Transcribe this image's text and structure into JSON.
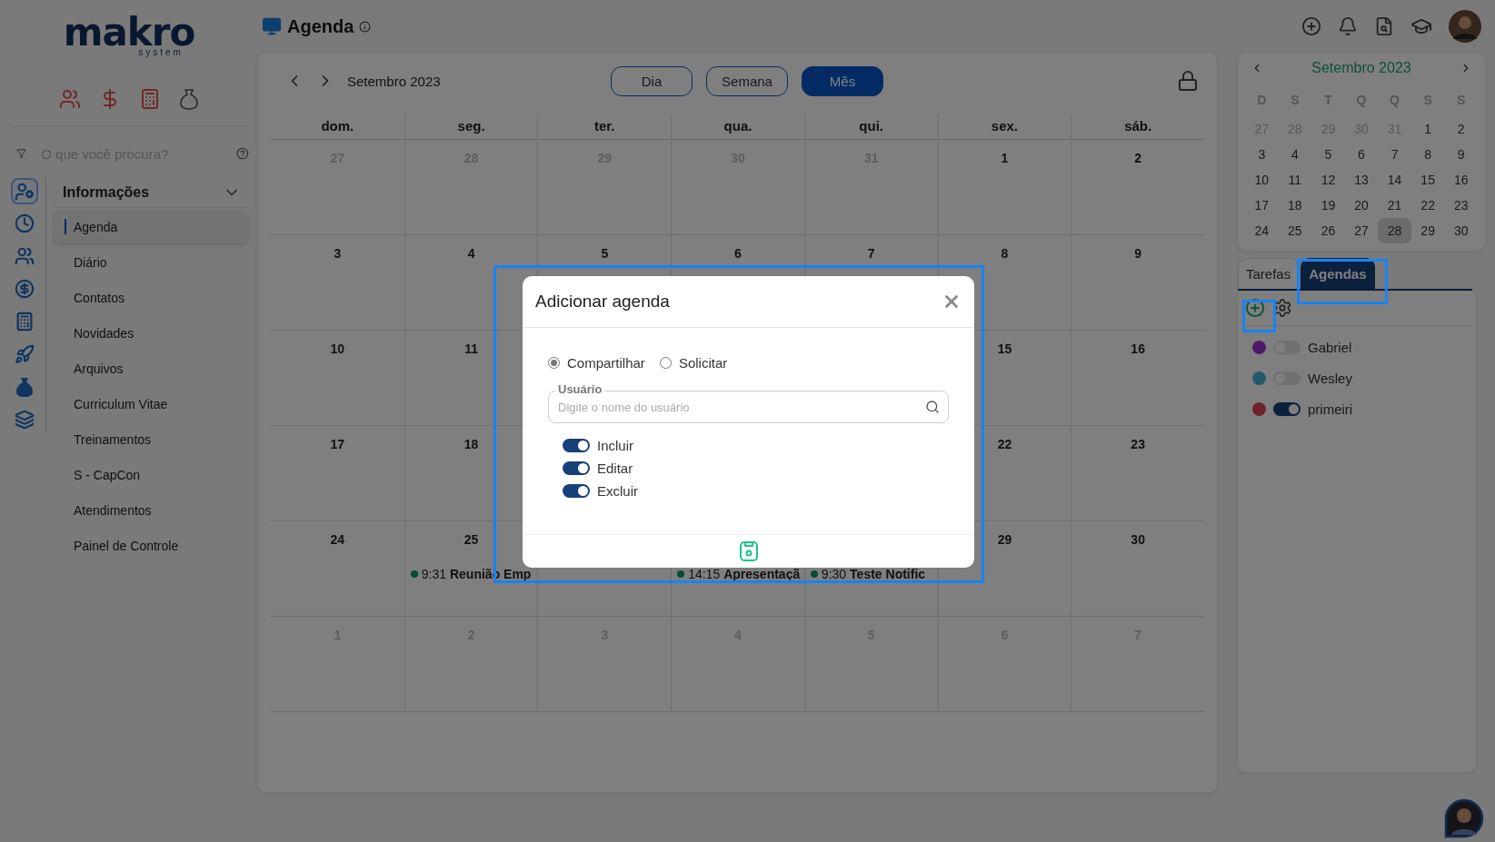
{
  "logo": {
    "text": "makro",
    "subtext": "system"
  },
  "sidebar": {
    "quick_icons": [
      {
        "kind": "people"
      },
      {
        "kind": "dollar"
      },
      {
        "kind": "calculator"
      },
      {
        "kind": "moneybag"
      }
    ],
    "search": {
      "placeholder": "O que você procura?"
    },
    "rail": [
      {
        "kind": "user",
        "selected": true
      },
      {
        "kind": "clock",
        "selected": false
      },
      {
        "kind": "people",
        "selected": false
      },
      {
        "kind": "dollar",
        "selected": false
      },
      {
        "kind": "calculator",
        "selected": false
      },
      {
        "kind": "rocket",
        "selected": false
      },
      {
        "kind": "moneybag",
        "selected": false
      },
      {
        "kind": "layers",
        "selected": false
      }
    ],
    "section": {
      "title": "Informações",
      "expanded": true
    },
    "items": [
      {
        "label": "Agenda",
        "selected": true
      },
      {
        "label": "Diário",
        "selected": false
      },
      {
        "label": "Contatos",
        "selected": false
      },
      {
        "label": "Novidades",
        "selected": false
      },
      {
        "label": "Arquivos",
        "selected": false
      },
      {
        "label": "Curriculum Vitae",
        "selected": false
      },
      {
        "label": "Treinamentos",
        "selected": false
      },
      {
        "label": "S - CapCon",
        "selected": false
      },
      {
        "label": "Atendimentos",
        "selected": false
      },
      {
        "label": "Painel de Controle",
        "selected": false
      }
    ]
  },
  "header": {
    "title": "Agenda"
  },
  "calendar": {
    "month": "Setembro 2023",
    "views": [
      {
        "label": "Dia",
        "selected": false
      },
      {
        "label": "Semana",
        "selected": false
      },
      {
        "label": "Mês",
        "selected": true
      }
    ],
    "weekdays": [
      "dom.",
      "seg.",
      "ter.",
      "qua.",
      "qui.",
      "sex.",
      "sáb."
    ],
    "weeks": [
      {
        "dom": {
          "day": "27",
          "outside": true
        },
        "seg": {
          "day": "28",
          "outside": true
        },
        "ter": {
          "day": "29",
          "outside": true
        },
        "qua": {
          "day": "30",
          "outside": true
        },
        "qui": {
          "day": "31",
          "outside": true
        },
        "sex": {
          "day": "1",
          "outside": false
        },
        "sab": {
          "day": "2",
          "outside": false
        }
      },
      {
        "dom": {
          "day": "3",
          "outside": false
        },
        "seg": {
          "day": "4",
          "outside": false
        },
        "ter": {
          "day": "5",
          "outside": false
        },
        "qua": {
          "day": "6",
          "outside": false
        },
        "qui": {
          "day": "7",
          "outside": false
        },
        "sex": {
          "day": "8",
          "outside": false
        },
        "sab": {
          "day": "9",
          "outside": false
        }
      },
      {
        "dom": {
          "day": "10",
          "outside": false
        },
        "seg": {
          "day": "11",
          "outside": false
        },
        "sex": {
          "day": "15",
          "outside": false
        },
        "sab": {
          "day": "16",
          "outside": false
        }
      },
      {
        "dom": {
          "day": "17",
          "outside": false
        },
        "seg": {
          "day": "18",
          "outside": false
        },
        "sex": {
          "day": "22",
          "outside": false
        },
        "sab": {
          "day": "23",
          "outside": false
        }
      },
      {
        "dom": {
          "day": "24",
          "outside": false
        },
        "seg": {
          "day": "25",
          "outside": false,
          "events": [
            {
              "time": "9:31",
              "title": "Reunião Emp"
            }
          ]
        },
        "qua": {
          "events": [
            {
              "time": "14:15",
              "title": "Apresentaçã"
            }
          ]
        },
        "qui": {
          "events": [
            {
              "time": "9:30",
              "title": "Teste Notific"
            }
          ]
        },
        "sex": {
          "day": "29",
          "outside": false
        },
        "sab": {
          "day": "30",
          "outside": false
        }
      },
      {
        "dom": {
          "day": "1",
          "outside": true
        },
        "seg": {
          "day": "2",
          "outside": true
        },
        "ter": {
          "day": "3",
          "outside": true
        },
        "qua": {
          "day": "4",
          "outside": true
        },
        "qui": {
          "day": "5",
          "outside": true
        },
        "sex": {
          "day": "6",
          "outside": true
        },
        "sab": {
          "day": "7",
          "outside": true
        }
      }
    ]
  },
  "mini_calendar": {
    "month": "Setembro 2023",
    "weekdays": [
      "D",
      "S",
      "T",
      "Q",
      "Q",
      "S",
      "S"
    ],
    "weeks": [
      [
        {
          "day": "27",
          "outside": true,
          "selected": false
        },
        {
          "day": "28",
          "outside": true,
          "selected": false
        },
        {
          "day": "29",
          "outside": true,
          "selected": false
        },
        {
          "day": "30",
          "outside": true,
          "selected": false
        },
        {
          "day": "31",
          "outside": true,
          "selected": false
        },
        {
          "day": "1",
          "outside": false,
          "selected": false
        },
        {
          "day": "2",
          "outside": false,
          "selected": false
        }
      ],
      [
        {
          "day": "3",
          "outside": false,
          "selected": false
        },
        {
          "day": "4",
          "outside": false,
          "selected": false
        },
        {
          "day": "5",
          "outside": false,
          "selected": false
        },
        {
          "day": "6",
          "outside": false,
          "selected": false
        },
        {
          "day": "7",
          "outside": false,
          "selected": false
        },
        {
          "day": "8",
          "outside": false,
          "selected": false
        },
        {
          "day": "9",
          "outside": false,
          "selected": false
        }
      ],
      [
        {
          "day": "10",
          "outside": false,
          "selected": false
        },
        {
          "day": "11",
          "outside": false,
          "selected": false
        },
        {
          "day": "12",
          "outside": false,
          "selected": false
        },
        {
          "day": "13",
          "outside": false,
          "selected": false
        },
        {
          "day": "14",
          "outside": false,
          "selected": false
        },
        {
          "day": "15",
          "outside": false,
          "selected": false
        },
        {
          "day": "16",
          "outside": false,
          "selected": false
        }
      ],
      [
        {
          "day": "17",
          "outside": false,
          "selected": false
        },
        {
          "day": "18",
          "outside": false,
          "selected": false
        },
        {
          "day": "19",
          "outside": false,
          "selected": false
        },
        {
          "day": "20",
          "outside": false,
          "selected": false
        },
        {
          "day": "21",
          "outside": false,
          "selected": false
        },
        {
          "day": "22",
          "outside": false,
          "selected": false
        },
        {
          "day": "23",
          "outside": false,
          "selected": false
        }
      ],
      [
        {
          "day": "24",
          "outside": false,
          "selected": false
        },
        {
          "day": "25",
          "outside": false,
          "selected": false
        },
        {
          "day": "26",
          "outside": false,
          "selected": false
        },
        {
          "day": "27",
          "outside": false,
          "selected": false
        },
        {
          "day": "28",
          "outside": false,
          "selected": true
        },
        {
          "day": "29",
          "outside": false,
          "selected": false
        },
        {
          "day": "30",
          "outside": false,
          "selected": false
        }
      ]
    ]
  },
  "tabs": [
    {
      "label": "Tarefas",
      "selected": false
    },
    {
      "label": "Agendas",
      "selected": true
    }
  ],
  "agendas": [
    {
      "name": "Gabriel",
      "color": "#4d1a6a",
      "on": false
    },
    {
      "name": "Wesley",
      "color": "#25586e",
      "on": false
    },
    {
      "name": "primeiri",
      "color": "#70222c",
      "on": true
    }
  ],
  "modal": {
    "title": "Adicionar agenda",
    "modes": [
      {
        "label": "Compartilhar",
        "selected": true
      },
      {
        "label": "Solicitar",
        "selected": false
      }
    ],
    "user_field": {
      "label": "Usuário",
      "placeholder": "Digite o nome do usuário"
    },
    "permissions": [
      {
        "label": "Incluir",
        "on": true
      },
      {
        "label": "Editar",
        "on": true
      },
      {
        "label": "Excluir",
        "on": true
      }
    ]
  }
}
